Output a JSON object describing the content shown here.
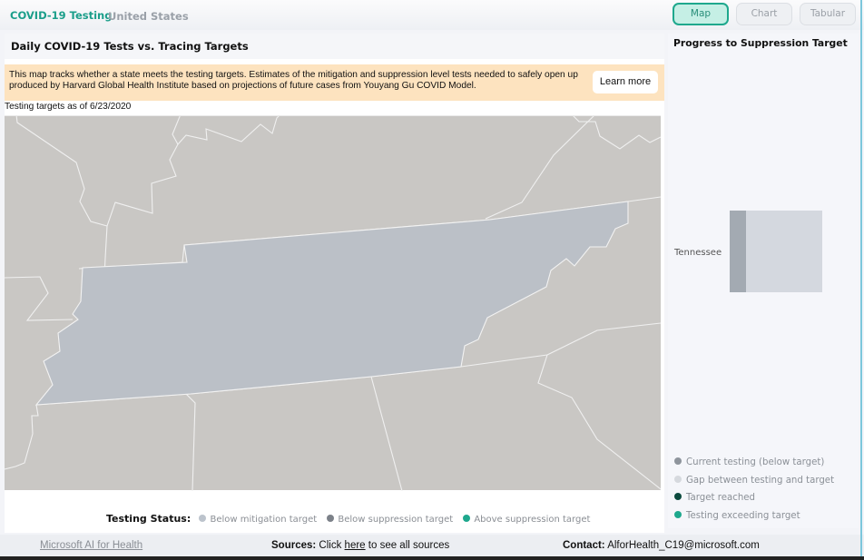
{
  "header": {
    "brand": "COVID-19 Testing",
    "region": "United States",
    "views": [
      {
        "label": "Map",
        "active": true
      },
      {
        "label": "Chart",
        "active": false
      },
      {
        "label": "Tabular",
        "active": false
      }
    ]
  },
  "main": {
    "title": "Daily COVID-19 Tests vs. Tracing Targets",
    "banner_text": "This map tracks whether a state meets the testing targets. Estimates of the mitigation and suppression level tests needed to safely open up produced by Harvard Global Health Institute based on projections of future cases from Youyang Gu COVID Model.",
    "learn_more": "Learn more",
    "as_of": "Testing targets as of 6/23/2020",
    "map": {
      "highlighted_state": "Tennessee",
      "highlighted_status": "Below mitigation target",
      "colors": {
        "land": "#c9c7c4",
        "highlighted": "#bbc0c7",
        "border": "#f2f2f2"
      }
    },
    "status": {
      "label": "Testing Status:",
      "items": [
        {
          "label": "Below mitigation target",
          "color": "#bcc3cc"
        },
        {
          "label": "Below suppression target",
          "color": "#7c8189"
        },
        {
          "label": "Above suppression target",
          "color": "#1ea88d"
        }
      ]
    }
  },
  "side": {
    "title": "Progress to Suppression Target",
    "bars": [
      {
        "state": "Tennessee",
        "current_fraction_of_target": 0.18
      }
    ],
    "legend": [
      {
        "label": "Current testing (below target)",
        "color": "#8e949c"
      },
      {
        "label": "Gap between testing and target",
        "color": "#d6d9de"
      },
      {
        "label": "Target reached",
        "color": "#0c4a3e"
      },
      {
        "label": "Testing exceeding target",
        "color": "#1ea88d"
      }
    ]
  },
  "footer": {
    "ms_link": "Microsoft AI for Health",
    "sources_label": "Sources:",
    "sources_pre": "Click",
    "sources_link": "here",
    "sources_post": "to see all sources",
    "contact_label": "Contact:",
    "contact_email": "AlforHealth_C19@microsoft.com"
  }
}
